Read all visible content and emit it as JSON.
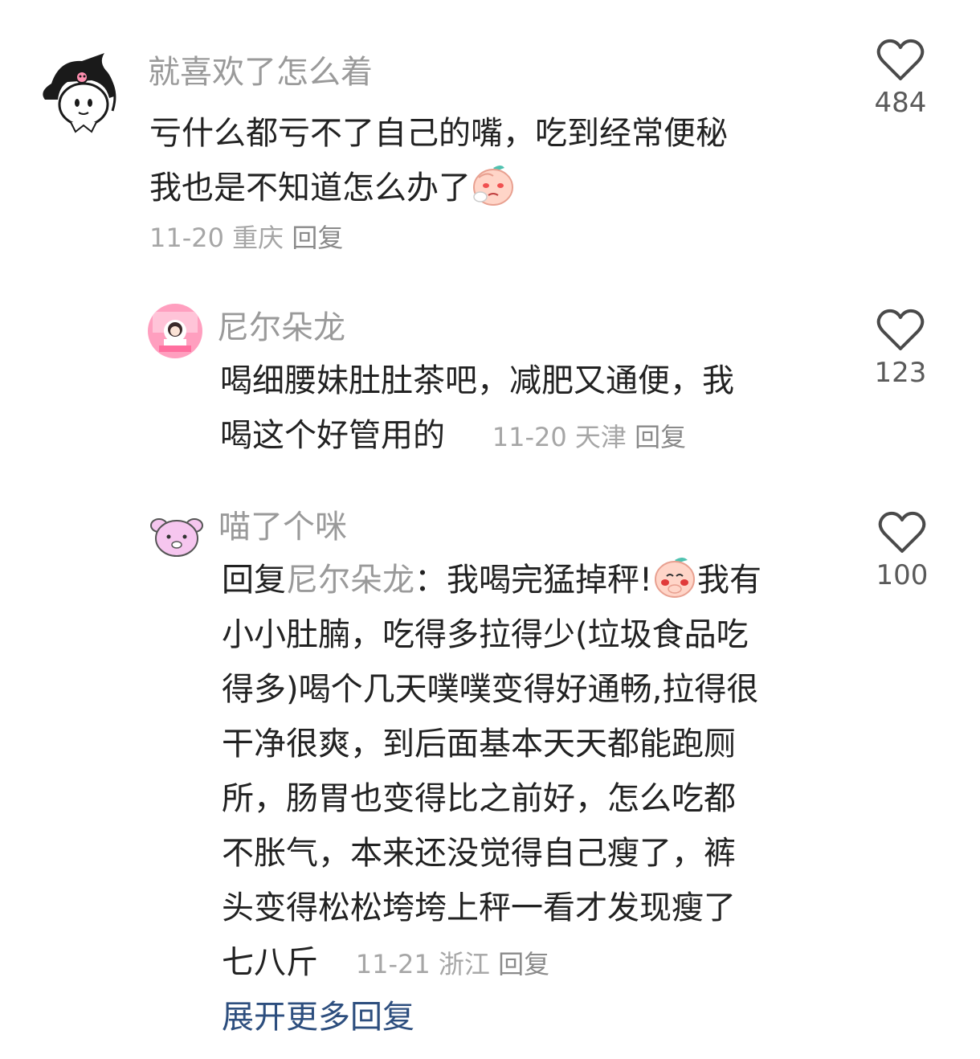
{
  "comments": [
    {
      "username": "就喜欢了怎么着",
      "text_line1": "亏什么都亏不了自己的嘴，吃到经常便秘",
      "text_line2": "我也是不知道怎么办了",
      "date": "11-20",
      "location": "重庆",
      "reply_label": "回复",
      "likes": "484",
      "avatar_icon": "kuromi-avatar-icon",
      "emoji_icon": "sick-peach-emoji-icon"
    }
  ],
  "replies": [
    {
      "username": "尼尔朵龙",
      "text_line1": "喝细腰妹肚肚茶吧，减肥又通便，我",
      "text_line2": "喝这个好管用的",
      "date": "11-20",
      "location": "天津",
      "reply_label": "回复",
      "likes": "123",
      "avatar_icon": "pink-room-avatar-icon"
    },
    {
      "username": "喵了个咪",
      "reply_prefix": "回复",
      "mention": "尼尔朵龙",
      "colon": "：",
      "text_line1": "我喝完猛掉秤!",
      "text_line1b": "我有",
      "lines": [
        "小小肚腩，吃得多拉得少(垃圾食品吃",
        "得多)喝个几天噗噗变得好通畅,拉得很",
        "干净很爽，到后面基本天天都能跑厕",
        "所，肠胃也变得比之前好，怎么吃都",
        "不胀气，本来还没觉得自己瘦了，裤",
        "头变得松松垮垮上秤一看才发现瘦了"
      ],
      "last_line": "七八斤",
      "date": "11-21",
      "location": "浙江",
      "reply_label": "回复",
      "likes": "100",
      "avatar_icon": "pink-piglet-avatar-icon",
      "emoji_icon": "shy-peach-emoji-icon"
    }
  ],
  "expand_more": "展开更多回复",
  "colors": {
    "username": "#9a9a9a",
    "text": "#222222",
    "meta": "#a6a6a6",
    "link": "#2d4e7e"
  }
}
